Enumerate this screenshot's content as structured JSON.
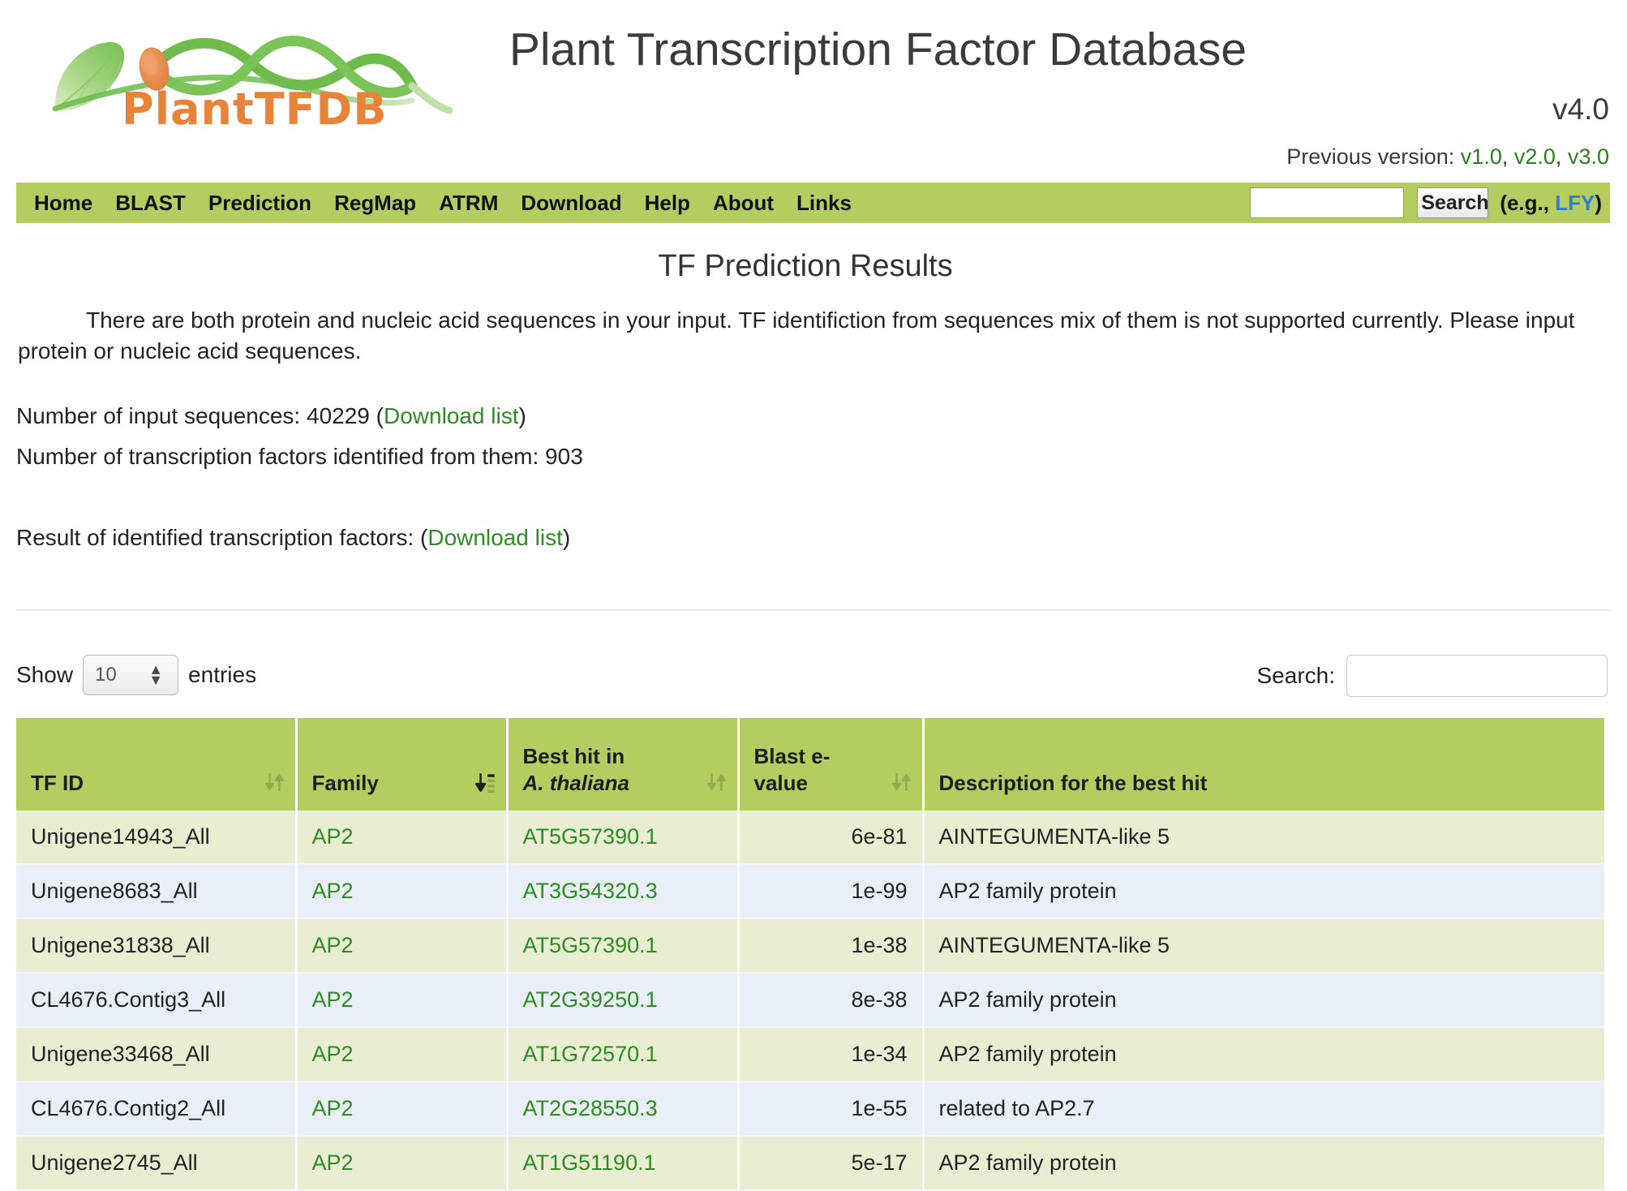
{
  "header": {
    "logo_wordmark": "PlantTFDB",
    "logo_icon": "leaf-dna-logo",
    "site_title": "Plant Transcription Factor Database",
    "version_current": "v4.0",
    "previous_version_label": "Previous version:",
    "previous_versions": [
      "v1.0",
      "v2.0",
      "v3.0"
    ]
  },
  "nav": {
    "items": [
      {
        "label": "Home",
        "name": "nav-item-home"
      },
      {
        "label": "BLAST",
        "name": "nav-item-blast"
      },
      {
        "label": "Prediction",
        "name": "nav-item-prediction"
      },
      {
        "label": "RegMap",
        "name": "nav-item-regmap"
      },
      {
        "label": "ATRM",
        "name": "nav-item-atrm"
      },
      {
        "label": "Download",
        "name": "nav-item-download"
      },
      {
        "label": "Help",
        "name": "nav-item-help"
      },
      {
        "label": "About",
        "name": "nav-item-about"
      },
      {
        "label": "Links",
        "name": "nav-item-links"
      }
    ],
    "search_value": "",
    "search_placeholder": "",
    "search_button_label": "Search",
    "search_hint_prefix": "(e.g., ",
    "search_hint_example": "LFY",
    "search_hint_suffix": ")"
  },
  "main": {
    "page_heading": "TF Prediction Results",
    "notice": "There are both protein and nucleic acid sequences in your input. TF identifiction from sequences mix of them is not supported currently. Please input protein or nucleic acid sequences.",
    "input_sequences_label": "Number of input sequences:",
    "input_sequences_count": "40229",
    "input_download_label": "Download list",
    "tf_identified_label": "Number of transcription factors identified from them:",
    "tf_identified_count": "903",
    "result_label": "Result of identified transcription factors:",
    "result_download_label": "Download list"
  },
  "table_controls": {
    "show_label": "Show",
    "entries_value": "10",
    "entries_label": "entries",
    "search_label": "Search:",
    "search_value": "",
    "search_placeholder": ""
  },
  "table": {
    "columns": [
      {
        "label_line1": "TF ID",
        "label_line2": "",
        "sort_state": "none",
        "align": "left"
      },
      {
        "label_line1": "Family",
        "label_line2": "",
        "sort_state": "asc",
        "align": "left"
      },
      {
        "label_line1": "Best hit in",
        "label_line2": "A. thaliana",
        "sort_state": "none",
        "align": "left"
      },
      {
        "label_line1": "Blast e-",
        "label_line2": "value",
        "sort_state": "none",
        "align": "left"
      },
      {
        "label_line1": "Description for the best hit",
        "label_line2": "",
        "sort_state": "none",
        "align": "left"
      }
    ],
    "rows": [
      {
        "tf_id": "Unigene14943_All",
        "family": "AP2",
        "best_hit": "AT5G57390.1",
        "evalue": "6e-81",
        "description": "AINTEGUMENTA-like 5"
      },
      {
        "tf_id": "Unigene8683_All",
        "family": "AP2",
        "best_hit": "AT3G54320.3",
        "evalue": "1e-99",
        "description": "AP2 family protein"
      },
      {
        "tf_id": "Unigene31838_All",
        "family": "AP2",
        "best_hit": "AT5G57390.1",
        "evalue": "1e-38",
        "description": "AINTEGUMENTA-like 5"
      },
      {
        "tf_id": "CL4676.Contig3_All",
        "family": "AP2",
        "best_hit": "AT2G39250.1",
        "evalue": "8e-38",
        "description": "AP2 family protein"
      },
      {
        "tf_id": "Unigene33468_All",
        "family": "AP2",
        "best_hit": "AT1G72570.1",
        "evalue": "1e-34",
        "description": "AP2 family protein"
      },
      {
        "tf_id": "CL4676.Contig2_All",
        "family": "AP2",
        "best_hit": "AT2G28550.3",
        "evalue": "1e-55",
        "description": "related to AP2.7"
      },
      {
        "tf_id": "Unigene2745_All",
        "family": "AP2",
        "best_hit": "AT1G51190.1",
        "evalue": "5e-17",
        "description": "AP2 family protein"
      }
    ]
  },
  "colors": {
    "nav_green": "#b5cc60",
    "link_green": "#2e8b23",
    "logo_orange": "#e8833a",
    "row_alt_a": "#e9eed3",
    "row_alt_b": "#e9eef7",
    "hint_blue": "#2b7fd1"
  }
}
